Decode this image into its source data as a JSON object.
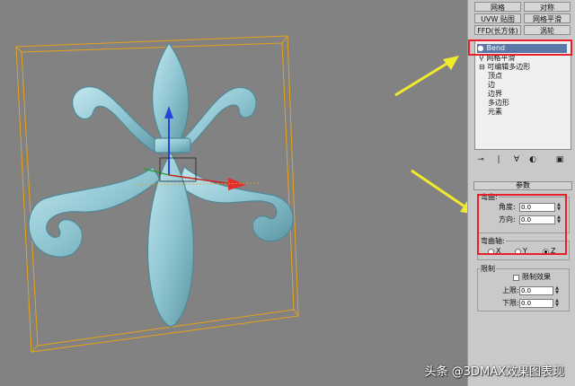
{
  "modifier_list": {
    "row1": [
      "网格",
      "对称"
    ],
    "row2": [
      "UVW 贴图",
      "网格平滑"
    ],
    "row3": [
      "FFD(长方体)",
      "涡轮"
    ]
  },
  "stack": {
    "items": [
      "Bend",
      "网格平滑",
      "可编辑多边形",
      "顶点",
      "边",
      "边界",
      "多边形",
      "元素"
    ]
  },
  "toolbar": [
    "⊸",
    "|",
    "∀",
    "◐",
    "▣"
  ],
  "params": {
    "header": "参数",
    "bend_group": "弯曲:",
    "angle_label": "角度:",
    "angle_value": "0.0",
    "direction_label": "方向:",
    "direction_value": "0.0",
    "axis_group": "弯曲轴:",
    "axes": [
      "X",
      "Y",
      "Z"
    ],
    "axis_selected": "Z",
    "limits_group": "限制",
    "limit_effect_label": "限制效果",
    "upper_label": "上限:",
    "upper_value": "0.0",
    "lower_label": "下限:",
    "lower_value": "0.0"
  },
  "colors": {
    "highlight_box": "#e8202a",
    "arrow": "#f2ea2c",
    "bbox": "#e8a21a",
    "model": "#8fc6d2"
  },
  "watermark": "头条 @3DMAX效果图表现"
}
